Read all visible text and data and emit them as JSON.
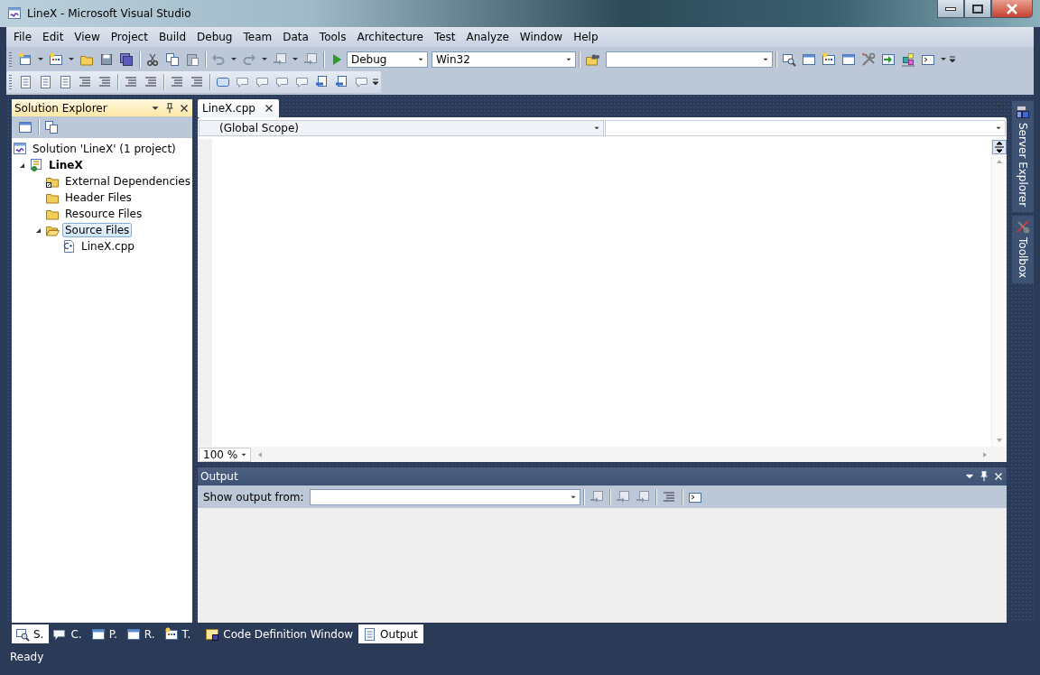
{
  "window": {
    "title": "LineX - Microsoft Visual Studio"
  },
  "menu": [
    "File",
    "Edit",
    "View",
    "Project",
    "Build",
    "Debug",
    "Team",
    "Data",
    "Tools",
    "Architecture",
    "Test",
    "Analyze",
    "Window",
    "Help"
  ],
  "toolbar": {
    "configuration": "Debug",
    "platform": "Win32"
  },
  "solution_explorer": {
    "title": "Solution Explorer",
    "tree": [
      {
        "label": "Solution 'LineX' (1 project)",
        "kind": "solution",
        "selected": false,
        "children": [
          {
            "label": "LineX",
            "kind": "project",
            "expanded": true,
            "selected": false,
            "children": [
              {
                "label": "External Dependencies",
                "kind": "linked-folder",
                "selected": false
              },
              {
                "label": "Header Files",
                "kind": "folder",
                "selected": false
              },
              {
                "label": "Resource Files",
                "kind": "folder",
                "selected": false
              },
              {
                "label": "Source Files",
                "kind": "open-folder",
                "expanded": true,
                "selected": true,
                "children": [
                  {
                    "label": "LineX.cpp",
                    "kind": "cpp",
                    "selected": false
                  }
                ]
              }
            ]
          }
        ]
      }
    ]
  },
  "editor": {
    "tabs": [
      {
        "label": "LineX.cpp",
        "selected": true
      }
    ],
    "scope": "(Global Scope)",
    "zoom": "100 %"
  },
  "output": {
    "title": "Output",
    "show_output_label": "Show output from:"
  },
  "side_tabs": [
    "Server Explorer",
    "Toolbox"
  ],
  "left_tabs": [
    {
      "label": "S.",
      "selected": true
    },
    {
      "label": "C.",
      "selected": false
    },
    {
      "label": "P.",
      "selected": false
    },
    {
      "label": "R.",
      "selected": false
    },
    {
      "label": "T.",
      "selected": false
    }
  ],
  "right_tabs": [
    {
      "label": "Code Definition Window",
      "selected": false
    },
    {
      "label": "Output",
      "selected": true
    }
  ],
  "status_bar": {
    "text": "Ready"
  }
}
